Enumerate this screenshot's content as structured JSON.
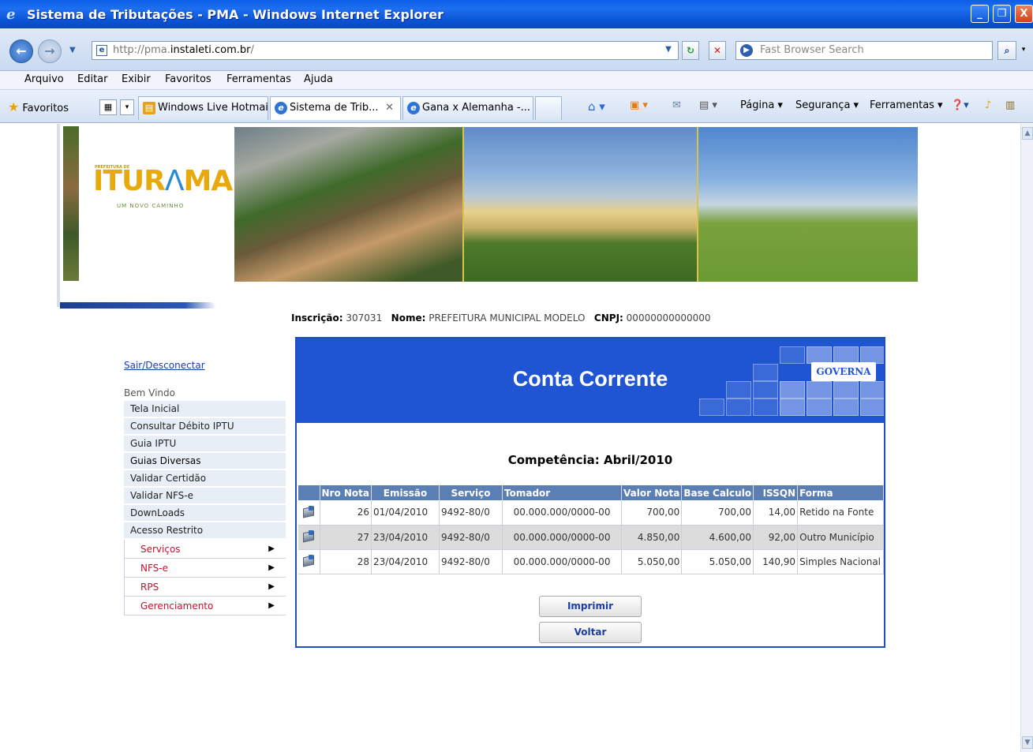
{
  "window": {
    "title": "Sistema de Tributações - PMA - Windows Internet Explorer",
    "controls": [
      "_",
      "❐",
      "X"
    ]
  },
  "address": {
    "url_prefix": "http://pma.",
    "url_host": "instaleti.com.br",
    "url_suffix": "/",
    "search_placeholder": "Fast Browser Search"
  },
  "menu": [
    "Arquivo",
    "Editar",
    "Exibir",
    "Favoritos",
    "Ferramentas",
    "Ajuda"
  ],
  "favbar": {
    "favorites_label": "Favoritos",
    "tabs": [
      "Windows Live Hotmail",
      "Sistema de Trib...",
      "Gana x Alemanha -..."
    ],
    "tools": [
      "Página ▾",
      "Segurança ▾",
      "Ferramentas ▾"
    ]
  },
  "banner": {
    "logo_prefix": "PREFEITURA DE",
    "logo_name_1": "ITUR",
    "logo_name_2": "Λ",
    "logo_name_3": "MA",
    "logo_sub": "UM NOVO CAMINHO"
  },
  "info": {
    "inscricao_label": "Inscrição:",
    "inscricao_value": "307031",
    "nome_label": "Nome:",
    "nome_value": "PREFEITURA MUNICIPAL MODELO",
    "cnpj_label": "CNPJ:",
    "cnpj_value": "00000000000000"
  },
  "sidebar": {
    "logout": "Sair/Desconectar",
    "welcome": "Bem Vindo",
    "items": [
      "Tela Inicial",
      "Consultar Débito IPTU",
      "Guia IPTU",
      "Guias Diversas",
      "Validar Certidão",
      "Validar NFS-e",
      "DownLoads",
      "Acesso Restrito"
    ],
    "subitems": [
      "Serviços",
      "NFS-e",
      "RPS",
      "Gerenciamento"
    ]
  },
  "panel": {
    "title": "Conta Corrente",
    "brand": "GOVERNA",
    "competencia": "Competência: Abril/2010",
    "columns": [
      "",
      "Nro Nota",
      "Emissão",
      "Serviço",
      "Tomador",
      "Valor Nota",
      "Base Calculo",
      "ISSQN",
      "Forma"
    ],
    "rows": [
      {
        "nro": "26",
        "emissao": "01/04/2010",
        "servico": "9492-80/0",
        "tomador": "00.000.000/0000-00",
        "valor": "700,00",
        "base": "700,00",
        "issqn": "14,00",
        "forma": "Retido na Fonte"
      },
      {
        "nro": "27",
        "emissao": "23/04/2010",
        "servico": "9492-80/0",
        "tomador": "00.000.000/0000-00",
        "valor": "4.850,00",
        "base": "4.600,00",
        "issqn": "92,00",
        "forma": "Outro Município"
      },
      {
        "nro": "28",
        "emissao": "23/04/2010",
        "servico": "9492-80/0",
        "tomador": "00.000.000/0000-00",
        "valor": "5.050,00",
        "base": "5.050,00",
        "issqn": "140,90",
        "forma": "Simples Nacional"
      }
    ],
    "print_button": "Imprimir",
    "back_button": "Voltar"
  }
}
